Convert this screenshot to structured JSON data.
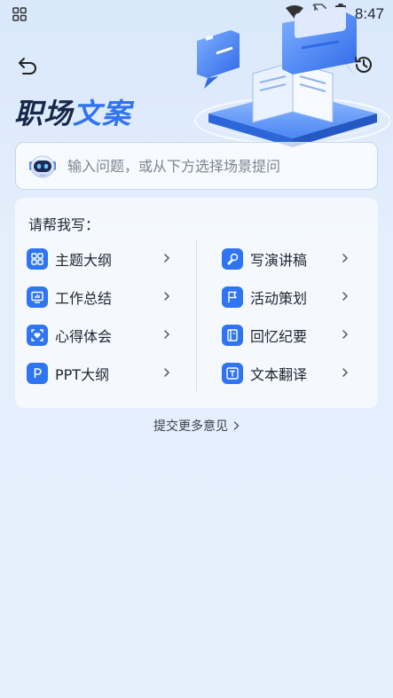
{
  "status_bar": {
    "time": "8:47"
  },
  "header": {
    "title_part1": "职场",
    "title_part2": "文案"
  },
  "search": {
    "placeholder": "输入问题，或从下方选择场景提问"
  },
  "card": {
    "heading": "请帮我写：",
    "left_items": [
      {
        "label": "主题大纲",
        "icon": "grid-icon"
      },
      {
        "label": "工作总结",
        "icon": "monitor-chart-icon"
      },
      {
        "label": "心得体会",
        "icon": "heart-frame-icon"
      },
      {
        "label": "PPT大纲",
        "icon": "p-letter-icon"
      }
    ],
    "right_items": [
      {
        "label": "写演讲稿",
        "icon": "microphone-icon"
      },
      {
        "label": "活动策划",
        "icon": "flag-icon"
      },
      {
        "label": "回忆纪要",
        "icon": "notebook-icon"
      },
      {
        "label": "文本翻译",
        "icon": "text-t-icon"
      }
    ]
  },
  "footer": {
    "feedback_label": "提交更多意见"
  },
  "colors": {
    "accent": "#2f74f0",
    "title_dark": "#17274a",
    "title_blue": "#2f73f0"
  }
}
